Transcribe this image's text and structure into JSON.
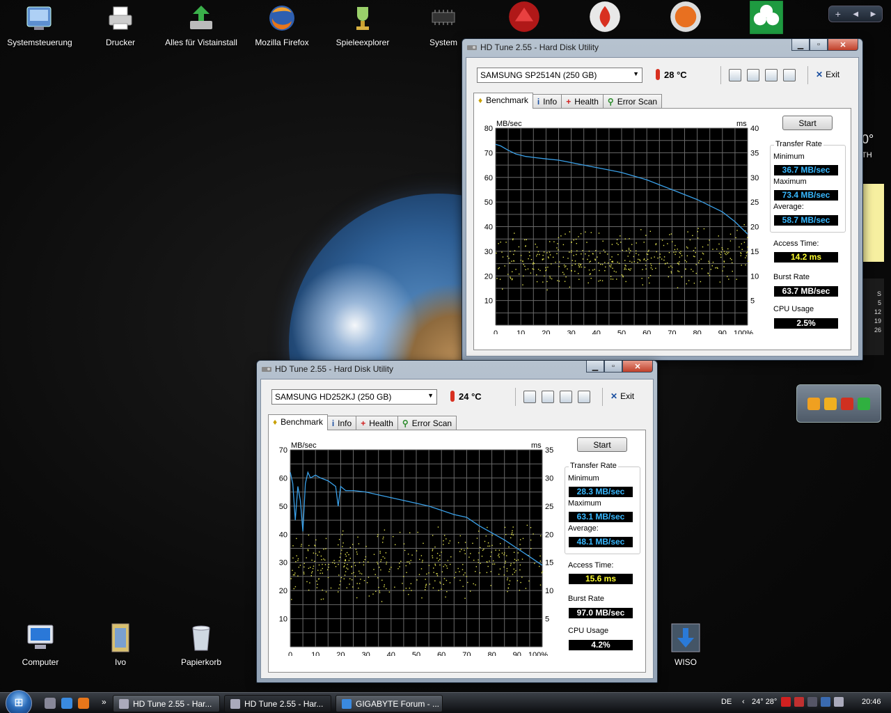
{
  "desktop": {
    "icons_top": [
      {
        "label": "Systemsteuerung"
      },
      {
        "label": "Drucker"
      },
      {
        "label": "Alles für Vistainstall"
      },
      {
        "label": "Mozilla Firefox"
      },
      {
        "label": "Spieleexplorer"
      },
      {
        "label": "System"
      }
    ],
    "icons_bottom": [
      {
        "label": "Computer"
      },
      {
        "label": "Ivo"
      },
      {
        "label": "Papierkorb"
      },
      {
        "label": "WISO"
      }
    ],
    "gadget_clock": {
      "degree": "0°",
      "abbr": "TH"
    },
    "gadget_calendar_days": [
      "S",
      "5",
      "12",
      "19",
      "26"
    ]
  },
  "window1": {
    "title": "HD Tune 2.55 - Hard Disk Utility",
    "drive": "SAMSUNG SP2514N (250 GB)",
    "temperature": "28 °C",
    "exit_label": "Exit",
    "tabs": [
      "Benchmark",
      "Info",
      "Health",
      "Error Scan"
    ],
    "start_label": "Start",
    "transfer_rate_title": "Transfer Rate",
    "min_label": "Minimum",
    "min_value": "36.7 MB/sec",
    "max_label": "Maximum",
    "max_value": "73.4 MB/sec",
    "avg_label": "Average:",
    "avg_value": "58.7 MB/sec",
    "access_label": "Access Time:",
    "access_value": "14.2 ms",
    "burst_label": "Burst Rate",
    "burst_value": "63.7 MB/sec",
    "cpu_label": "CPU Usage",
    "cpu_value": "2.5%"
  },
  "window2": {
    "title": "HD Tune 2.55 - Hard Disk Utility",
    "drive": "SAMSUNG HD252KJ (250 GB)",
    "temperature": "24 °C",
    "exit_label": "Exit",
    "tabs": [
      "Benchmark",
      "Info",
      "Health",
      "Error Scan"
    ],
    "start_label": "Start",
    "transfer_rate_title": "Transfer Rate",
    "min_label": "Minimum",
    "min_value": "28.3 MB/sec",
    "max_label": "Maximum",
    "max_value": "63.1 MB/sec",
    "avg_label": "Average:",
    "avg_value": "48.1 MB/sec",
    "access_label": "Access Time:",
    "access_value": "15.6 ms",
    "burst_label": "Burst Rate",
    "burst_value": "97.0 MB/sec",
    "cpu_label": "CPU Usage",
    "cpu_value": "4.2%"
  },
  "chart_data": [
    {
      "type": "line",
      "ylabel": "MB/sec",
      "y2label": "ms",
      "ylim": [
        0,
        80
      ],
      "y2lim": [
        0,
        40
      ],
      "y_ticks": [
        10,
        20,
        30,
        40,
        50,
        60,
        70,
        80
      ],
      "y2_ticks": [
        5,
        10,
        15,
        20,
        25,
        30,
        35,
        40
      ],
      "x_ticks": [
        "0",
        "10",
        "20",
        "30",
        "40",
        "50",
        "60",
        "70",
        "80",
        "90",
        "100%"
      ],
      "grid": true,
      "series": [
        {
          "name": "Transfer Rate",
          "color": "#3aa0e8",
          "x": [
            0,
            2,
            5,
            8,
            12,
            16,
            20,
            25,
            30,
            35,
            40,
            45,
            50,
            55,
            60,
            65,
            70,
            75,
            80,
            85,
            90,
            95,
            100
          ],
          "values": [
            73.4,
            72.8,
            71,
            69.5,
            68.5,
            68,
            67.5,
            67,
            66,
            65,
            64,
            63,
            62,
            60.5,
            59,
            57,
            55,
            53,
            51,
            48.5,
            46,
            42,
            37
          ]
        },
        {
          "name": "Access Time",
          "color": "#e8e850",
          "style": "scatter",
          "range_ms": [
            6,
            19
          ]
        }
      ]
    },
    {
      "type": "line",
      "ylabel": "MB/sec",
      "y2label": "ms",
      "ylim": [
        0,
        70
      ],
      "y2lim": [
        0,
        35
      ],
      "y_ticks": [
        10,
        20,
        30,
        40,
        50,
        60,
        70
      ],
      "y2_ticks": [
        5,
        10,
        15,
        20,
        25,
        30,
        35
      ],
      "x_ticks": [
        "0",
        "10",
        "20",
        "30",
        "40",
        "50",
        "60",
        "70",
        "80",
        "90",
        "100%"
      ],
      "grid": true,
      "series": [
        {
          "name": "Transfer Rate",
          "color": "#3aa0e8",
          "x": [
            0,
            1,
            2,
            3,
            4,
            5,
            6,
            7,
            8,
            10,
            12,
            15,
            18,
            19,
            20,
            22,
            25,
            30,
            35,
            40,
            45,
            50,
            55,
            60,
            65,
            70,
            75,
            80,
            85,
            90,
            95,
            100
          ],
          "values": [
            62,
            58,
            45,
            57,
            52,
            41,
            58,
            62,
            60,
            61,
            60,
            59,
            57,
            50,
            57,
            55.5,
            55.5,
            55,
            54,
            53,
            52,
            51,
            50,
            48.5,
            47,
            46,
            43,
            40.5,
            38,
            35,
            32,
            29
          ]
        },
        {
          "name": "Access Time",
          "color": "#e8e850",
          "style": "scatter",
          "range_ms": [
            7,
            21
          ]
        }
      ]
    }
  ],
  "taskbar": {
    "tasks": [
      "HD Tune 2.55 - Har...",
      "HD Tune 2.55 - Har...",
      "GIGABYTE Forum - ..."
    ],
    "language": "DE",
    "temps": "24° 28°",
    "time": "20:46"
  }
}
